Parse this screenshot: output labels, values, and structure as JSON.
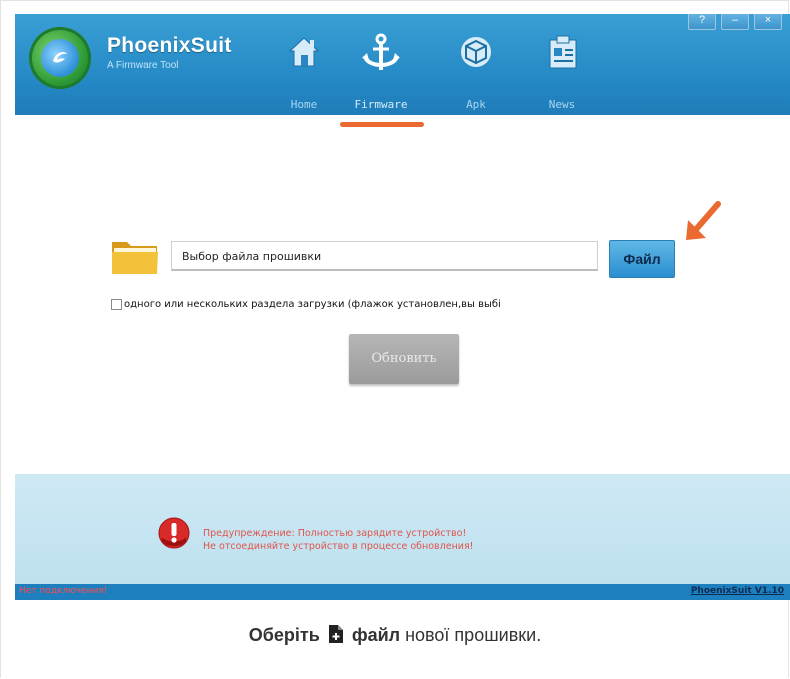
{
  "app": {
    "name": "PhoenixSuit",
    "subtitle": "A Firmware Tool"
  },
  "window_controls": [
    "?",
    "–",
    "×"
  ],
  "nav": {
    "items": [
      {
        "label": "Home",
        "icon": "home-icon"
      },
      {
        "label": "Firmware",
        "icon": "anchor-icon",
        "active": true
      },
      {
        "label": "Apk",
        "icon": "box-icon"
      },
      {
        "label": "News",
        "icon": "news-icon"
      }
    ]
  },
  "firmware": {
    "file_placeholder": "Выбор файла прошивки",
    "file_button": "Файл",
    "checkbox_label": "одного  или нескольких  раздела  загрузки (флажок установлен,вы выбі",
    "update_button": "Обновить"
  },
  "warning": {
    "line1": "Предупреждение: Полностью зарядите устройство!",
    "line2": "Не отсоединяйте устройство в процессе обновления!"
  },
  "status": {
    "connection": "Нет подключения!",
    "version": "PhoenixSuit V1.10"
  },
  "caption": {
    "part1": "Оберіть",
    "part2": "файл",
    "part3": " нової прошивки."
  },
  "colors": {
    "title_bar": "#2387c4",
    "active_indicator": "#ea6a32",
    "arrow": "#ea6a32",
    "warning_text": "#e0544c",
    "status_error": "#ff4a4a"
  }
}
